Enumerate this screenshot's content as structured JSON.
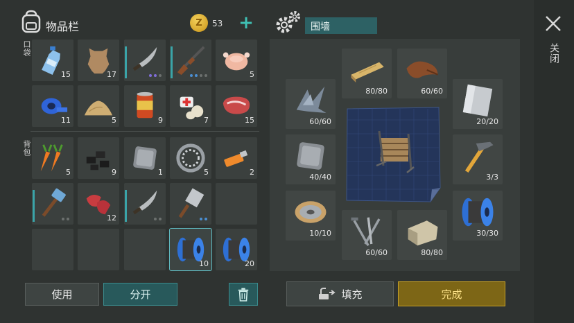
{
  "inventory": {
    "title": "物品栏",
    "coins": "53",
    "pocket_label": "口袋",
    "backpack_label": "背包",
    "pocket": [
      {
        "icon": "water-bottle-icon",
        "count": "15"
      },
      {
        "icon": "leather-hide-icon",
        "count": "17"
      },
      {
        "icon": "machete-icon",
        "count": ""
      },
      {
        "icon": "shotgun-icon",
        "count": ""
      },
      {
        "icon": "chicken-icon",
        "count": "5"
      },
      {
        "icon": "duct-tape-icon",
        "count": "11"
      },
      {
        "icon": "sand-pile-icon",
        "count": "5"
      },
      {
        "icon": "canned-food-icon",
        "count": "9"
      },
      {
        "icon": "bandage-icon",
        "count": "7"
      },
      {
        "icon": "raw-steak-icon",
        "count": "15"
      }
    ],
    "backpack": [
      {
        "icon": "carrot-icon",
        "count": "5"
      },
      {
        "icon": "coal-icon",
        "count": "9"
      },
      {
        "icon": "metal-plate-icon",
        "count": "1"
      },
      {
        "icon": "bearing-ring-icon",
        "count": "5"
      },
      {
        "icon": "usb-drive-icon",
        "count": "2"
      },
      {
        "icon": "hammer-icon",
        "count": ""
      },
      {
        "icon": "raw-meat-icon",
        "count": "12"
      },
      {
        "icon": "machete-icon",
        "count": ""
      },
      {
        "icon": "cleaver-icon",
        "count": ""
      },
      {
        "icon": "empty",
        "count": ""
      },
      {
        "icon": "empty",
        "count": ""
      },
      {
        "icon": "empty",
        "count": ""
      },
      {
        "icon": "empty",
        "count": ""
      },
      {
        "icon": "wire-spool-icon",
        "count": "10"
      },
      {
        "icon": "wire-spool-icon",
        "count": "20"
      }
    ],
    "use_label": "使用",
    "split_label": "分开"
  },
  "crafting": {
    "recipe_name": "围墙",
    "ingredients": [
      {
        "icon": "wood-plank-icon",
        "count": "80/80"
      },
      {
        "icon": "leather-icon",
        "count": "60/60"
      },
      {
        "icon": "metal-scrap-icon",
        "count": "60/60"
      },
      {
        "icon": "metal-sheet-icon",
        "count": "20/20"
      },
      {
        "icon": "metal-plate-icon",
        "count": "40/40"
      },
      {
        "icon": "hammer-tool-icon",
        "count": "3/3"
      },
      {
        "icon": "wire-coil-icon",
        "count": "10/10"
      },
      {
        "icon": "wire-spool-icon",
        "count": "30/30"
      },
      {
        "icon": "nails-icon",
        "count": "60/60"
      },
      {
        "icon": "stone-block-icon",
        "count": "80/80"
      }
    ],
    "fill_label": "填充",
    "done_label": "完成"
  },
  "close_label": "关闭",
  "colors": {
    "accent_teal": "#2c5f62",
    "gold": "#c9a226"
  }
}
